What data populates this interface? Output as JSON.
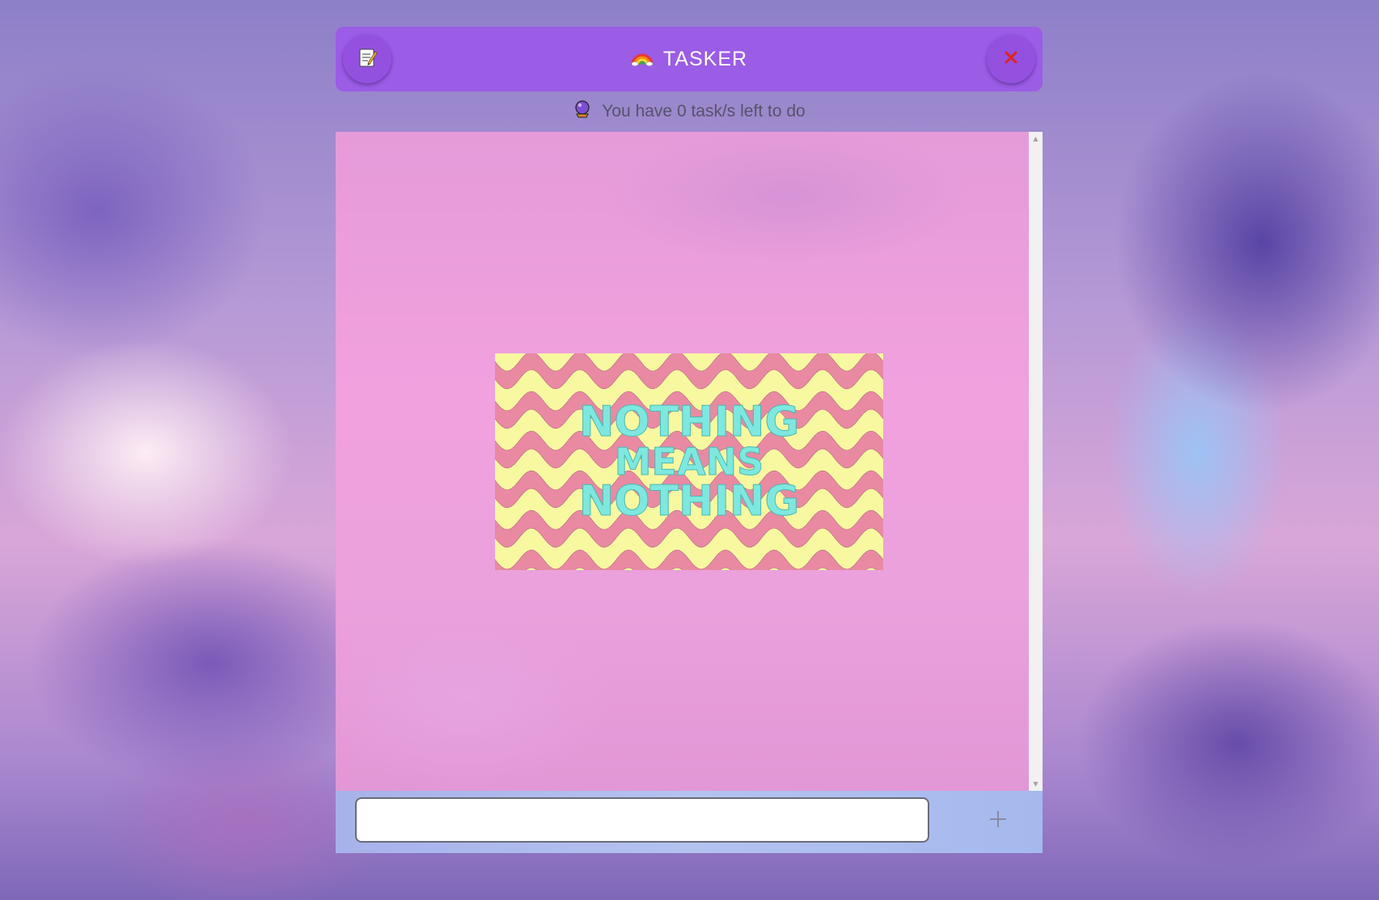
{
  "header": {
    "title": "TASKER",
    "title_emoji": "🌈",
    "notes_icon": "memo-icon",
    "close_icon": "close-x-icon"
  },
  "status": {
    "icon": "crystal-ball-icon",
    "text": "You have 0 task/s left to do"
  },
  "empty_state": {
    "lines": [
      "NOTHING",
      "MEANS",
      "NOTHING"
    ]
  },
  "footer": {
    "input_value": "",
    "add_icon": "plus-icon"
  },
  "colors": {
    "header_bg": "#9b5ce6",
    "button_bg": "#9451df",
    "close_x": "#e0231c",
    "list_bg": "#f1a1de",
    "wave_yellow": "#f8f8a0",
    "wave_pink": "#e98aa2",
    "empty_text": "#7ee8df"
  }
}
